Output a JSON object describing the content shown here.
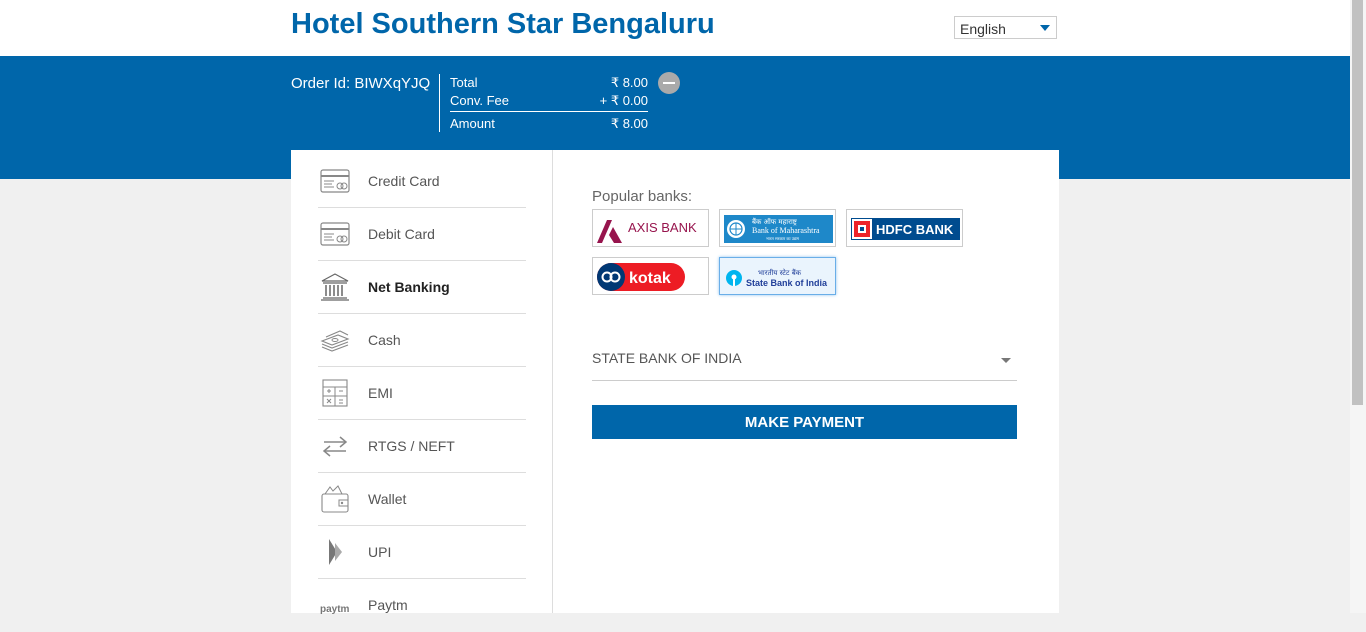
{
  "header": {
    "hotel_name": "Hotel Southern Star Bengaluru",
    "language": {
      "selected": "English"
    }
  },
  "order": {
    "order_id_label": "Order Id: BIWXqYJQ",
    "summary": [
      {
        "label": "Total",
        "value": "₹ 8.00"
      },
      {
        "label": "Conv. Fee",
        "value": "+ ₹ 0.00"
      },
      {
        "label": "Amount",
        "value": "₹ 8.00"
      }
    ]
  },
  "sidebar": {
    "items": [
      {
        "label": "Credit Card",
        "icon": "credit-card-icon",
        "active": false
      },
      {
        "label": "Debit Card",
        "icon": "debit-card-icon",
        "active": false
      },
      {
        "label": "Net Banking",
        "icon": "bank-building-icon",
        "active": true
      },
      {
        "label": "Cash",
        "icon": "cash-stack-icon",
        "active": false
      },
      {
        "label": "EMI",
        "icon": "calculator-icon",
        "active": false
      },
      {
        "label": "RTGS / NEFT",
        "icon": "transfer-arrows-icon",
        "active": false
      },
      {
        "label": "Wallet",
        "icon": "wallet-icon",
        "active": false
      },
      {
        "label": "UPI",
        "icon": "upi-icon",
        "active": false
      },
      {
        "label": "Paytm",
        "icon": "paytm-icon",
        "active": false
      }
    ],
    "paytm_icon_text": "paytm"
  },
  "net_banking": {
    "popular_label": "Popular banks:",
    "banks": {
      "axis": {
        "text": "AXIS BANK",
        "color": "#97144d"
      },
      "maharashtra": {
        "text_hindi": "बैंक ऑफ महाराष्ट्र",
        "text": "Bank of Maharashtra",
        "tagline": "भारत सरकार का उद्यम",
        "color": "#1e88c9"
      },
      "hdfc": {
        "text": "HDFC BANK",
        "color": "#004c8f",
        "accent": "#ed232a"
      },
      "kotak": {
        "text": "kotak",
        "color": "#ed1c24",
        "navy": "#003874"
      },
      "sbi": {
        "text_hindi": "भारतीय स्टेट बैंक",
        "text": "State Bank of India",
        "color": "#22409a",
        "accent": "#00b5ef",
        "selected": true
      }
    },
    "selected_bank": "STATE BANK OF INDIA",
    "pay_button": "MAKE PAYMENT"
  },
  "colors": {
    "brand": "#0066aa"
  }
}
